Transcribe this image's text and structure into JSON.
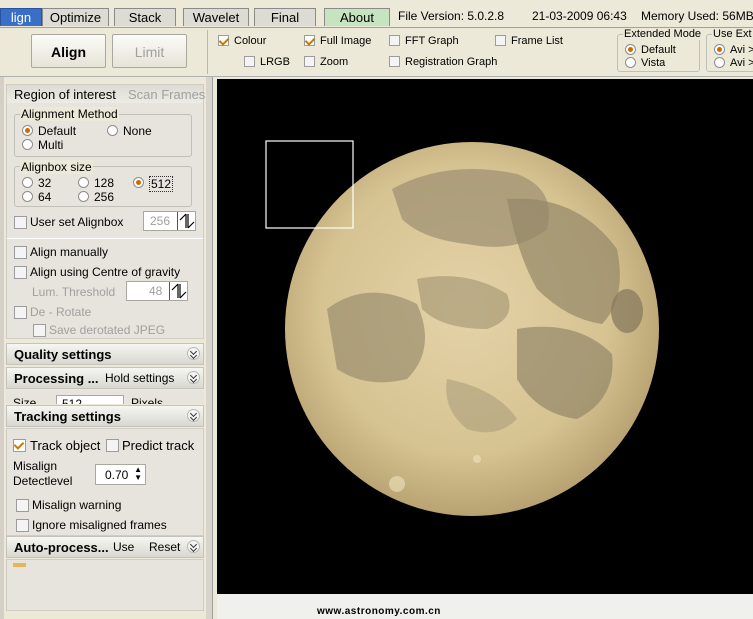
{
  "tabs": [
    {
      "label": "lign",
      "active": true
    },
    {
      "label": "Optimize"
    },
    {
      "label": "Stack"
    },
    {
      "label": "Wavelet"
    },
    {
      "label": "Final"
    },
    {
      "label": "About"
    }
  ],
  "info": {
    "version": "File Version: 5.0.2.8",
    "datetime": "21-03-2009 06:43",
    "memory": "Memory Used: 56MB"
  },
  "toolbar": {
    "align_label": "Align",
    "limit_label": "Limit",
    "checks": {
      "colour": "Colour",
      "full_image": "Full Image",
      "fft_graph": "FFT Graph",
      "frame_list": "Frame List",
      "lrgb": "LRGB",
      "zoom": "Zoom",
      "registration_graph": "Registration Graph"
    },
    "extended_mode": {
      "title": "Extended Mode",
      "opt1": "Default",
      "opt2": "Vista"
    },
    "use_ext": {
      "title": "Use  Ext",
      "opt1": "Avi >",
      "opt2": "Avi >"
    }
  },
  "panel": {
    "roi_header": "Region of interest",
    "scan_frames": "Scan Frames",
    "alignment_method": {
      "title": "Alignment Method",
      "default": "Default",
      "none": "None",
      "multi": "Multi"
    },
    "alignbox_size": {
      "title": "Alignbox size",
      "o32": "32",
      "o128": "128",
      "o512": "512",
      "o64": "64",
      "o256": "256"
    },
    "user_set_alignbox": "User set Alignbox",
    "user_set_value": "256",
    "align_manually": "Align manually",
    "align_centre": "Align using Centre of gravity",
    "lum_threshold": "Lum. Threshold",
    "lum_value": "48",
    "de_rotate": "De - Rotate",
    "save_derotated": "Save derotated JPEG",
    "quality_settings": "Quality settings",
    "processing": "Processing ...",
    "hold_settings": "Hold settings",
    "size_partial": "Size",
    "size_value": "512",
    "pixels_partial": "Pixels",
    "tracking_settings": "Tracking settings",
    "track_object": "Track object",
    "predict_track": "Predict track",
    "misalign_label1": "Misalign",
    "misalign_label2": "Detectlevel",
    "misalign_value": "0.70",
    "misalign_warning": "Misalign warning",
    "ignore_misaligned": "Ignore misaligned frames",
    "auto_process": "Auto-process...",
    "use": "Use",
    "reset": "Reset"
  },
  "viewer": {
    "watermark": "www.astronomy.com.cn"
  },
  "colors": {
    "accent": "#3a6fc8",
    "check": "#c8780a",
    "moon": "#d8c69a"
  }
}
